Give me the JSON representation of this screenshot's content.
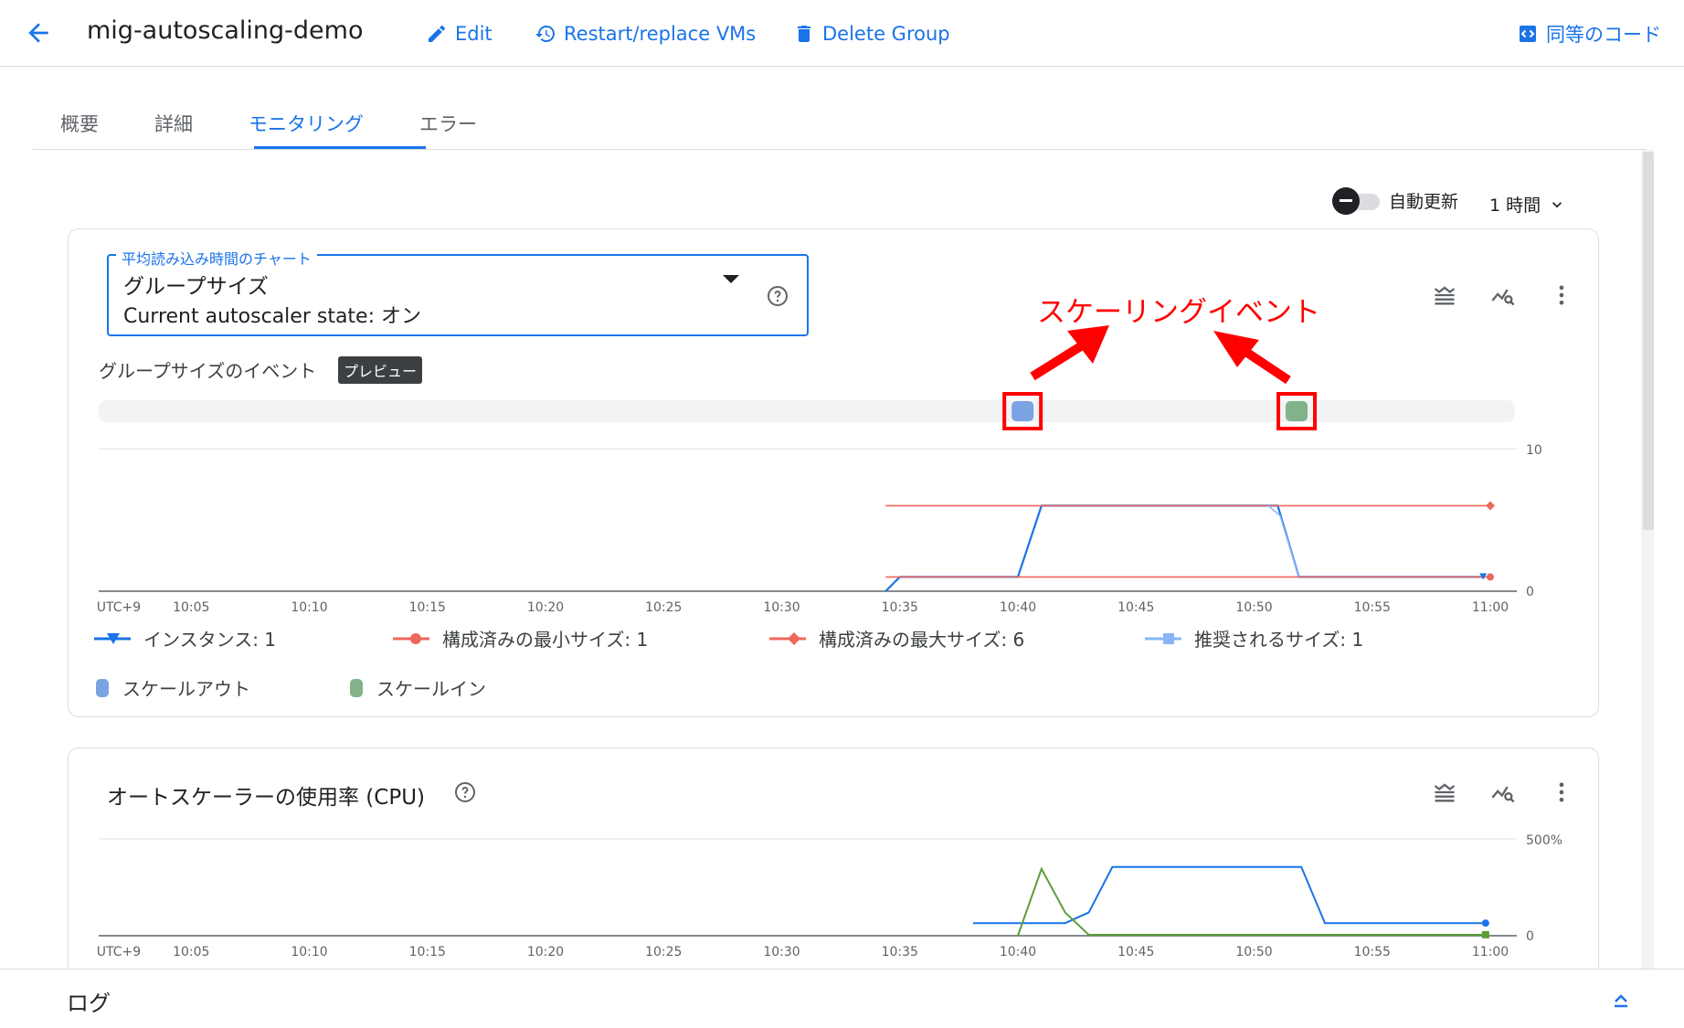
{
  "header": {
    "title": "mig-autoscaling-demo",
    "edit_label": "Edit",
    "restart_label": "Restart/replace VMs",
    "delete_label": "Delete Group",
    "code_label": "同等のコード"
  },
  "tabs": [
    {
      "label": "概要",
      "active": false
    },
    {
      "label": "詳細",
      "active": false
    },
    {
      "label": "モニタリング",
      "active": true
    },
    {
      "label": "エラー",
      "active": false
    }
  ],
  "toolbar": {
    "auto_refresh_label": "自動更新",
    "time_range": "1 時間"
  },
  "chart1": {
    "select_legend": "平均読み込み時間のチャート",
    "select_value": "グループサイズ",
    "select_sub": "Current autoscaler state: オン",
    "events_label": "グループサイズのイベント",
    "preview_badge": "プレビュー",
    "annotation": "スケーリングイベント",
    "legend": [
      {
        "label": "インスタンス: 1",
        "color": "#1a73e8"
      },
      {
        "label": "構成済みの最小サイズ: 1",
        "color": "#ee675c"
      },
      {
        "label": "構成済みの最大サイズ: 6",
        "color": "#ee675c"
      },
      {
        "label": "推奨されるサイズ: 1",
        "color": "#8ab4f8"
      }
    ],
    "event_legend": [
      {
        "label": "スケールアウト",
        "color": "#7ba2e3"
      },
      {
        "label": "スケールイン",
        "color": "#81b28a"
      }
    ]
  },
  "chart2": {
    "title": "オートスケーラーの使用率 (CPU)"
  },
  "logs": {
    "title": "ログ"
  },
  "chart_data": [
    {
      "type": "line",
      "x_ticks": [
        "UTC+9",
        "10:05",
        "10:10",
        "10:15",
        "10:20",
        "10:25",
        "10:30",
        "10:35",
        "10:40",
        "10:45",
        "10:50",
        "10:55",
        "11:00"
      ],
      "y_ticks": [
        "0",
        "10"
      ],
      "ylim": [
        0,
        10
      ],
      "series": [
        {
          "name": "インスタンス",
          "color": "#1a73e8",
          "points": [
            [
              34.4,
              0
            ],
            [
              35,
              1
            ],
            [
              40,
              1
            ],
            [
              41,
              6
            ],
            [
              51,
              6
            ],
            [
              51.9,
              1
            ],
            [
              59.7,
              1
            ]
          ]
        },
        {
          "name": "構成済みの最小サイズ",
          "color": "#ee675c",
          "points": [
            [
              34.4,
              1
            ],
            [
              60,
              1
            ]
          ]
        },
        {
          "name": "構成済みの最大サイズ",
          "color": "#ee675c",
          "points": [
            [
              34.4,
              6
            ],
            [
              60,
              6
            ]
          ]
        },
        {
          "name": "推奨されるサイズ",
          "color": "#8ab4f8",
          "points": [
            [
              50.6,
              6
            ],
            [
              51.1,
              5.3
            ],
            [
              51.9,
              1
            ]
          ]
        }
      ],
      "events": [
        {
          "type": "スケールアウト",
          "x": 40.2,
          "color": "#7ba2e3"
        },
        {
          "type": "スケールイン",
          "x": 51.8,
          "color": "#81b28a"
        }
      ]
    },
    {
      "type": "line",
      "x_ticks": [
        "UTC+9",
        "10:05",
        "10:10",
        "10:15",
        "10:20",
        "10:25",
        "10:30",
        "10:35",
        "10:40",
        "10:45",
        "10:50",
        "10:55",
        "11:00"
      ],
      "y_ticks": [
        "0",
        "500%"
      ],
      "ylim": [
        0,
        500
      ],
      "series": [
        {
          "color": "#1a73e8",
          "points": [
            [
              38.1,
              65
            ],
            [
              42,
              65
            ],
            [
              43,
              120
            ],
            [
              44,
              355
            ],
            [
              52,
              355
            ],
            [
              53,
              65
            ],
            [
              59.8,
              65
            ]
          ]
        },
        {
          "color": "#5a9e3a",
          "points": [
            [
              40,
              0
            ],
            [
              41,
              345
            ],
            [
              42,
              120
            ],
            [
              43,
              5
            ],
            [
              59.8,
              5
            ]
          ]
        }
      ]
    }
  ]
}
